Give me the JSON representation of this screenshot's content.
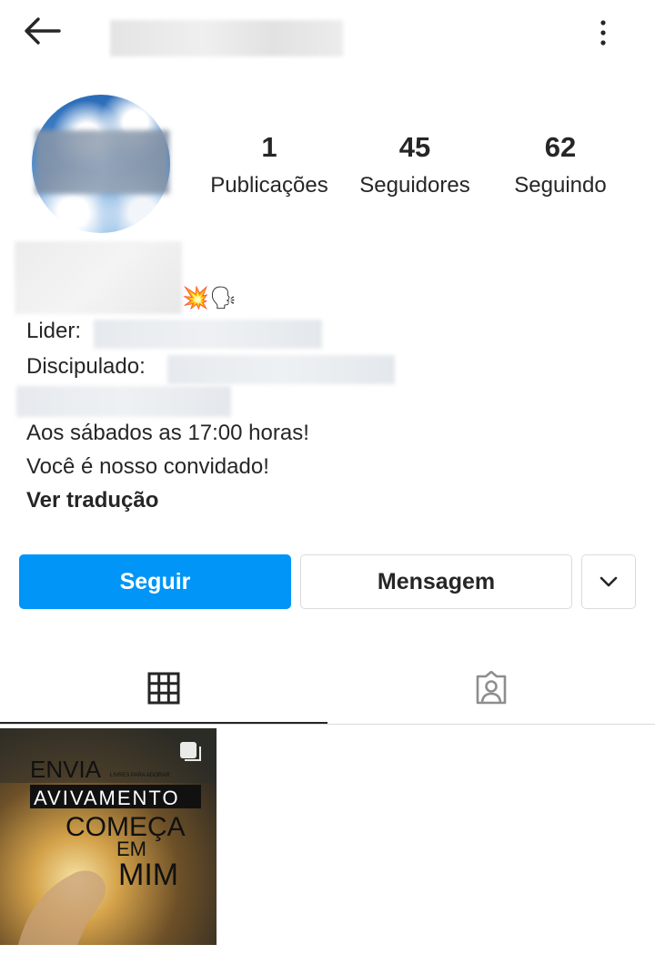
{
  "header": {
    "back_icon": "arrow-left-icon",
    "more_icon": "more-vertical-icon"
  },
  "stats": {
    "posts": {
      "count": "1",
      "label": "Publicações"
    },
    "followers": {
      "count": "45",
      "label": "Seguidores"
    },
    "following": {
      "count": "62",
      "label": "Seguindo"
    }
  },
  "bio": {
    "name_emoji": "💥🗣",
    "leader_label": "Lider:",
    "discipled_label": "Discipulado:",
    "line1": "Aos sábados as 17:00 horas!",
    "line2": "Você é nosso convidado!",
    "see_translation": "Ver tradução"
  },
  "actions": {
    "follow": "Seguir",
    "message": "Mensagem",
    "dropdown_icon": "chevron-down-icon"
  },
  "tabs": [
    {
      "icon": "grid-icon",
      "active": true
    },
    {
      "icon": "tagged-person-icon",
      "active": false
    }
  ],
  "posts": [
    {
      "line1": "ENVIA",
      "line2": "AVIVAMENTO",
      "line3": "COMEÇA",
      "line4": "EM",
      "line5": "MIM",
      "small_text": "LIVRES PARA ADORAR",
      "icon": "multi-post-icon"
    }
  ],
  "colors": {
    "accent": "#0095f6",
    "text": "#262626",
    "border": "#dbdbdb"
  }
}
